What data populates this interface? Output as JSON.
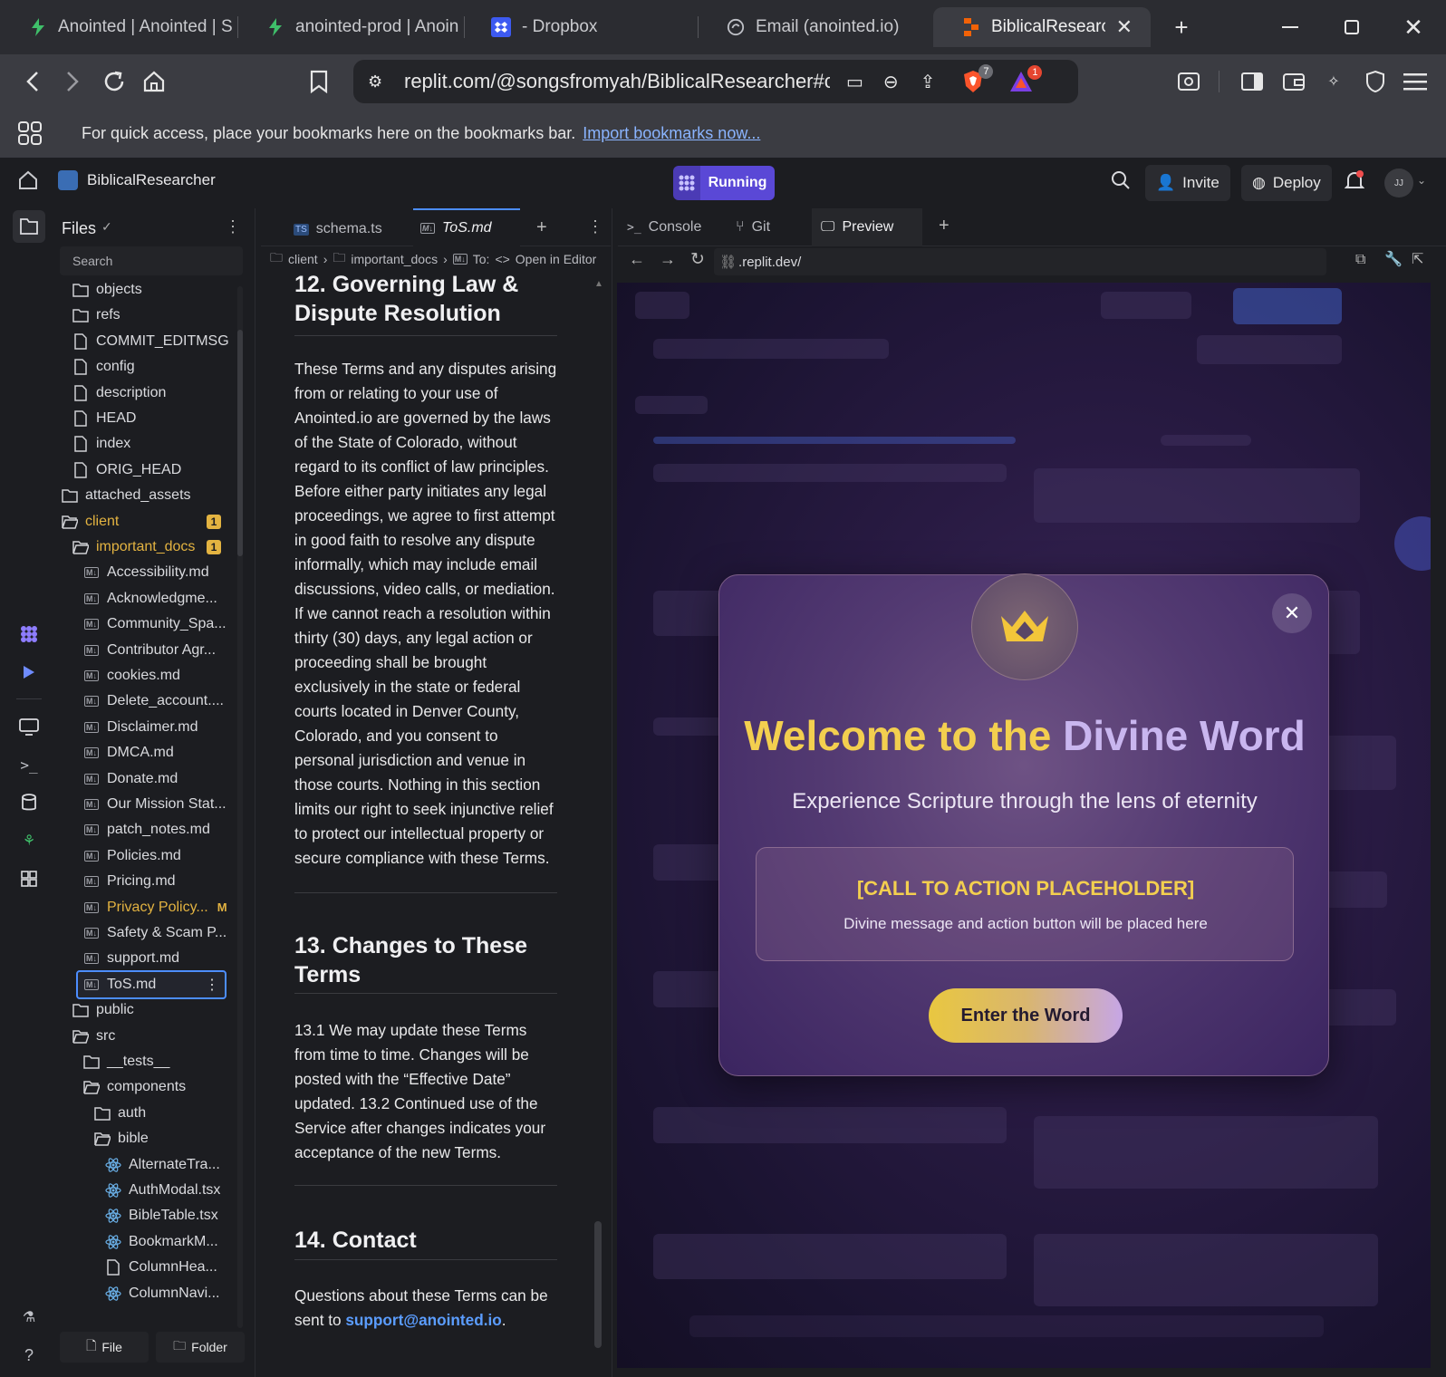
{
  "browser": {
    "tabs": [
      {
        "label": "Anointed | Anointed | S"
      },
      {
        "label": "anointed-prod | Anoin"
      },
      {
        "label": "- Dropbox"
      },
      {
        "label": "Email (anointed.io)"
      },
      {
        "label": "BiblicalResearcher"
      }
    ],
    "url": "replit.com/@songsfromyah/BiblicalResearcher#cli...",
    "shield_count": "7",
    "alert_count": "1",
    "bookmarks_message": "For quick access, place your bookmarks here on the bookmarks bar.",
    "bookmarks_link": "Import bookmarks now..."
  },
  "replit": {
    "project_name": "BiblicalResearcher",
    "run_status": "Running",
    "invite_label": "Invite",
    "deploy_label": "Deploy",
    "avatar_initials": "JJ"
  },
  "files": {
    "title": "Files",
    "search_placeholder": "Search",
    "items": [
      {
        "name": "objects",
        "type": "folder",
        "depth": 1
      },
      {
        "name": "refs",
        "type": "folder",
        "depth": 1
      },
      {
        "name": "COMMIT_EDITMSG",
        "type": "file",
        "depth": 1
      },
      {
        "name": "config",
        "type": "file",
        "depth": 1
      },
      {
        "name": "description",
        "type": "file",
        "depth": 1
      },
      {
        "name": "HEAD",
        "type": "file",
        "depth": 1
      },
      {
        "name": "index",
        "type": "file",
        "depth": 1
      },
      {
        "name": "ORIG_HEAD",
        "type": "file",
        "depth": 1
      },
      {
        "name": "attached_assets",
        "type": "folder",
        "depth": 0
      },
      {
        "name": "client",
        "type": "folder-open",
        "depth": 0,
        "badge": "1",
        "color": "#e3b341"
      },
      {
        "name": "important_docs",
        "type": "folder-open",
        "depth": 1,
        "badge": "1",
        "color": "#e3b341"
      },
      {
        "name": "Accessibility.md",
        "type": "md",
        "depth": 2
      },
      {
        "name": "Acknowledgme...",
        "type": "md",
        "depth": 2
      },
      {
        "name": "Community_Spa...",
        "type": "md",
        "depth": 2
      },
      {
        "name": "Contributor Agr...",
        "type": "md",
        "depth": 2
      },
      {
        "name": "cookies.md",
        "type": "md",
        "depth": 2
      },
      {
        "name": "Delete_account....",
        "type": "md",
        "depth": 2
      },
      {
        "name": "Disclaimer.md",
        "type": "md",
        "depth": 2
      },
      {
        "name": "DMCA.md",
        "type": "md",
        "depth": 2
      },
      {
        "name": "Donate.md",
        "type": "md",
        "depth": 2
      },
      {
        "name": "Our Mission Stat...",
        "type": "md",
        "depth": 2
      },
      {
        "name": "patch_notes.md",
        "type": "md",
        "depth": 2
      },
      {
        "name": "Policies.md",
        "type": "md",
        "depth": 2
      },
      {
        "name": "Pricing.md",
        "type": "md",
        "depth": 2
      },
      {
        "name": "Privacy Policy...",
        "type": "md",
        "depth": 2,
        "flag": "M",
        "color": "#e3b341"
      },
      {
        "name": "Safety & Scam P...",
        "type": "md",
        "depth": 2
      },
      {
        "name": "support.md",
        "type": "md",
        "depth": 2
      },
      {
        "name": "ToS.md",
        "type": "md",
        "depth": 2,
        "selected": true
      },
      {
        "name": "public",
        "type": "folder",
        "depth": 1
      },
      {
        "name": "src",
        "type": "folder-open",
        "depth": 1
      },
      {
        "name": "__tests__",
        "type": "folder",
        "depth": 2
      },
      {
        "name": "components",
        "type": "folder-open",
        "depth": 2
      },
      {
        "name": "auth",
        "type": "folder",
        "depth": 3
      },
      {
        "name": "bible",
        "type": "folder-open",
        "depth": 3
      },
      {
        "name": "AlternateTra...",
        "type": "react",
        "depth": 4
      },
      {
        "name": "AuthModal.tsx",
        "type": "react",
        "depth": 4
      },
      {
        "name": "BibleTable.tsx",
        "type": "react",
        "depth": 4
      },
      {
        "name": "BookmarkM...",
        "type": "react",
        "depth": 4
      },
      {
        "name": "ColumnHea...",
        "type": "file",
        "depth": 4
      },
      {
        "name": "ColumnNavi...",
        "type": "react",
        "depth": 4
      }
    ],
    "new_file_label": "File",
    "new_folder_label": "Folder"
  },
  "editor": {
    "tabs": [
      {
        "label": "schema.ts"
      },
      {
        "label": "ToS.md"
      }
    ],
    "breadcrumb": [
      "client",
      "important_docs",
      "To:"
    ],
    "open_in_editor": "Open in Editor",
    "sections": [
      {
        "heading": "12. Governing Law & Dispute Resolution",
        "body": "These Terms and any disputes arising from or relating to your use of Anointed.io are governed by the laws of the State of Colorado, without regard to its conflict of law principles. Before either party initiates any legal proceedings, we agree to first attempt in good faith to resolve any dispute informally, which may include email discussions, video calls, or mediation. If we cannot reach a resolution within thirty (30) days, any legal action or proceeding shall be brought exclusively in the state or federal courts located in Denver County, Colorado, and you consent to personal jurisdiction and venue in those courts. Nothing in this section limits our right to seek injunctive relief to protect our intellectual property or secure compliance with these Terms."
      },
      {
        "heading": "13. Changes to These Terms",
        "body": "13.1 We may update these Terms from time to time. Changes will be posted with the “Effective Date” updated. 13.2 Continued use of the Service after changes indicates your acceptance of the new Terms."
      },
      {
        "heading": "14. Contact",
        "body_prefix": "Questions about these Terms can be sent to ",
        "email": "support@anointed.io",
        "body_suffix": "."
      }
    ]
  },
  "preview": {
    "tabs": [
      {
        "label": "Console"
      },
      {
        "label": "Git"
      },
      {
        "label": "Preview"
      }
    ],
    "url": ".replit.dev/",
    "modal": {
      "title_part1": "Welcome to the ",
      "title_part2": "Divine Word",
      "subtitle": "Experience Scripture through the lens of eternity",
      "cta_title": "[CALL TO ACTION PLACEHOLDER]",
      "cta_text": "Divine message and action button will be placed here",
      "button_label": "Enter the Word"
    },
    "colors": {
      "gold": "#f3cf4f",
      "lavender": "#c9b6ef",
      "purple_bg": "#2a1b45"
    }
  }
}
